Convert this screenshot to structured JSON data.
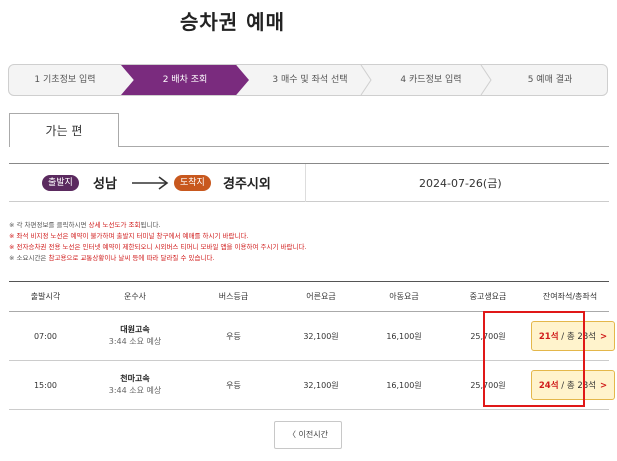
{
  "page": {
    "title": "승차권 예매"
  },
  "steps": [
    {
      "label": "1 기초정보 입력"
    },
    {
      "label": "2 배차 조회"
    },
    {
      "label": "3 매수 및 좌석 선택"
    },
    {
      "label": "4 카드정보 입력"
    },
    {
      "label": "5 예매 결과"
    }
  ],
  "tab": {
    "label": "가는 편"
  },
  "route": {
    "departure_badge": "출발지",
    "departure": "성남",
    "arrival_badge": "도착지",
    "arrival": "경주시외",
    "date": "2024-07-26(금)"
  },
  "notices": {
    "n1_a": "※ 각 차편정보를 클릭하시면 ",
    "n1_b": "상세 노선도가 조회",
    "n1_c": "됩니다.",
    "n2": "※ 좌석 비지정 노선은 예약이 불가하며 출발지 터미널 창구에서 예매를 하시기 바랍니다.",
    "n3": "※ 전자승차권 전용 노선은 인터넷 예약이 제한되오니 시외버스 티머니 모바일 앱을 이용하여 주시기 바랍니다.",
    "n4_a": "※ 소요시간은 ",
    "n4_b": "참고용으로 교통상황이나 날씨 등에 따라 달라질 수 있습니다."
  },
  "table": {
    "headers": [
      "출발시각",
      "운수사",
      "버스등급",
      "어른요금",
      "아동요금",
      "중고생요금",
      "잔여좌석/총좌석"
    ],
    "rows": [
      {
        "time": "07:00",
        "company": "대원고속",
        "duration": "3:44 소요 예상",
        "grade": "우등",
        "adult": "32,100원",
        "child": "16,100원",
        "youth": "25,700원",
        "seats_available": "21석",
        "seats_total": " / 총 28석",
        "chevron": ">"
      },
      {
        "time": "15:00",
        "company": "천마고속",
        "duration": "3:44 소요 예상",
        "grade": "우등",
        "adult": "32,100원",
        "child": "16,100원",
        "youth": "25,700원",
        "seats_available": "24석",
        "seats_total": " / 총 28석",
        "chevron": ">"
      }
    ]
  },
  "prev_button": {
    "label": "〈 이전시간"
  },
  "colors": {
    "active_step": "#7a2b7e",
    "departure_badge": "#5b2a5f",
    "arrival_badge": "#c8581e",
    "seat_button_bg": "#fff3cc",
    "highlight": "#e01818"
  },
  "icons": {
    "route_arrow": "long-right-arrow-icon",
    "step_separator": "chevron-right-icon"
  }
}
